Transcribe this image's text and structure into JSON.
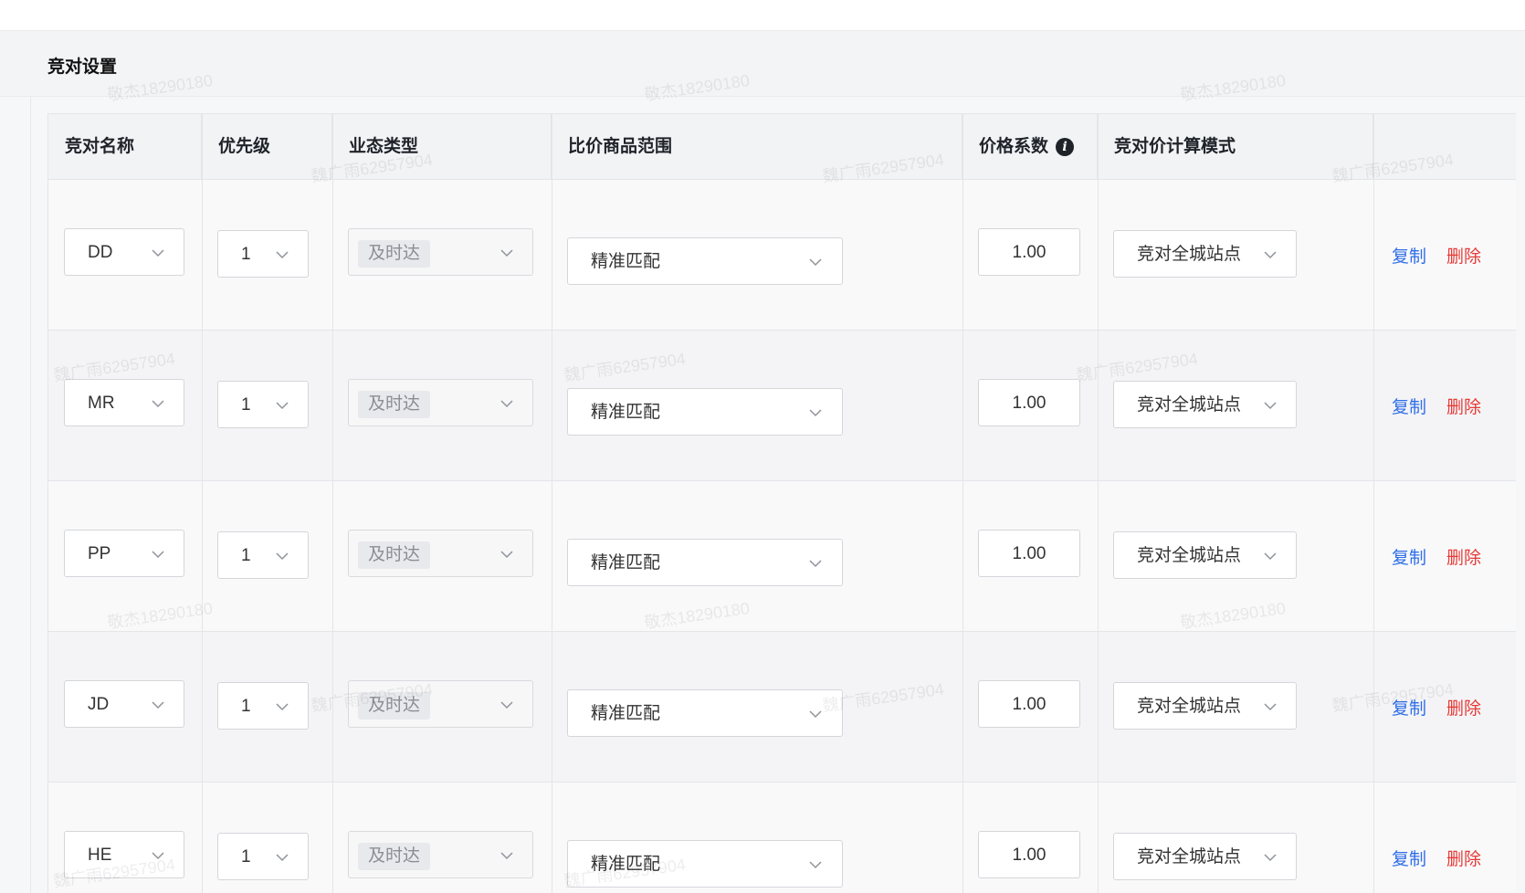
{
  "section": {
    "title": "竞对设置"
  },
  "table": {
    "headers": {
      "name": "竞对名称",
      "priority": "优先级",
      "business_type": "业态类型",
      "compare_scope": "比价商品范围",
      "price_factor": "价格系数",
      "calc_mode": "竞对价计算模式"
    },
    "rows": [
      {
        "name": "DD",
        "priority": "1",
        "business_type": "及时达",
        "compare_scope": "精准匹配",
        "price_factor": "1.00",
        "calc_mode": "竞对全城站点",
        "copy": "复制",
        "delete": "删除"
      },
      {
        "name": "MR",
        "priority": "1",
        "business_type": "及时达",
        "compare_scope": "精准匹配",
        "price_factor": "1.00",
        "calc_mode": "竞对全城站点",
        "copy": "复制",
        "delete": "删除"
      },
      {
        "name": "PP",
        "priority": "1",
        "business_type": "及时达",
        "compare_scope": "精准匹配",
        "price_factor": "1.00",
        "calc_mode": "竞对全城站点",
        "copy": "复制",
        "delete": "删除"
      },
      {
        "name": "JD",
        "priority": "1",
        "business_type": "及时达",
        "compare_scope": "精准匹配",
        "price_factor": "1.00",
        "calc_mode": "竞对全城站点",
        "copy": "复制",
        "delete": "删除"
      },
      {
        "name": "HE",
        "priority": "1",
        "business_type": "及时达",
        "compare_scope": "精准匹配",
        "price_factor": "1.00",
        "calc_mode": "竞对全城站点",
        "copy": "复制",
        "delete": "删除"
      }
    ]
  },
  "watermarks": [
    "敬杰18290180",
    "魏广雨62957904"
  ],
  "icons": {
    "info": "info-icon",
    "dropdown": "chevron-down-icon"
  },
  "colors": {
    "link": "#2f6ee8",
    "danger": "#e53935"
  }
}
